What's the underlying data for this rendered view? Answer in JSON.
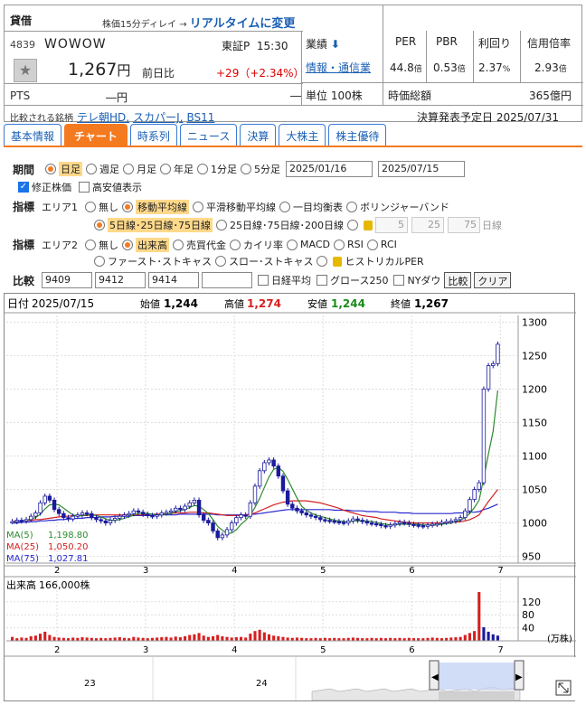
{
  "header": {
    "badge": "貸借",
    "delay_text": "株価15分ディレイ →",
    "realtime_link": "リアルタイムに変更",
    "code": "4839",
    "name": "WOWOW",
    "market": "東証P",
    "time": "15:30",
    "price": "1,267",
    "price_unit": "円",
    "prev_label": "前日比",
    "change": "+29",
    "change_pct": "（+2.34%）",
    "pts_label": "PTS",
    "pts_value": "―円",
    "pts_change": "―",
    "compare_label": "比較される銘柄",
    "compare_links": [
      "テレ朝HD,",
      "スカパーJ,",
      "BS11"
    ],
    "gyoseki_label": "業績",
    "industry": "情報・通信業",
    "lot": "単位 100株",
    "per_label": "PER",
    "per_value": "44.8",
    "per_unit": "倍",
    "pbr_label": "PBR",
    "pbr_value": "0.53",
    "pbr_unit": "倍",
    "yield_label": "利回り",
    "yield_value": "2.37",
    "yield_unit": "%",
    "margin_label": "信用倍率",
    "margin_value": "2.93",
    "margin_unit": "倍",
    "mcap_label": "時価総額",
    "mcap_value": "365億円",
    "earnings_label": "決算発表予定日",
    "earnings_date": "2025/07/31"
  },
  "tabs": [
    "基本情報",
    "チャート",
    "時系列",
    "ニュース",
    "決算",
    "大株主",
    "株主優待"
  ],
  "controls": {
    "period_label": "期間",
    "periods": [
      "日足",
      "週足",
      "月足",
      "年足",
      "1分足",
      "5分足"
    ],
    "date_from": "2025/01/16",
    "date_to": "2025/07/15",
    "adjusted": "修正株価",
    "highlow": "高安値表示",
    "indicator_label": "指標",
    "area1": "エリア1",
    "area1_opts": [
      "無し",
      "移動平均線",
      "平滑移動平均線",
      "一目均衡表",
      "ボリンジャーバンド"
    ],
    "ma_opts": [
      "5日線･25日線･75日線",
      "25日線･75日線･200日線"
    ],
    "custom_ma": [
      "5",
      "25",
      "75"
    ],
    "custom_ma_unit": "日線",
    "area2": "エリア2",
    "area2_opts_a": [
      "無し",
      "出来高",
      "売買代金",
      "カイリ率",
      "MACD",
      "RSI",
      "RCI"
    ],
    "area2_opts_b": [
      "ファースト･ストキャス",
      "スロー･ストキャス",
      "ヒストリカルPER"
    ],
    "compare_label": "比較",
    "compare_codes": [
      "9409",
      "9412",
      "9414",
      ""
    ],
    "compare_indices": [
      "日経平均",
      "グロース250",
      "NYダウ"
    ],
    "compare_btn": "比較",
    "clear_btn": "クリア"
  },
  "chart_info": {
    "date_label": "日付",
    "date": "2025/07/15",
    "open_label": "始値",
    "open": "1,244",
    "high_label": "高値",
    "high": "1,274",
    "low_label": "安値",
    "low": "1,244",
    "close_label": "終値",
    "close": "1,267",
    "ma5": "MA(5)",
    "ma5_val": "1,198.80",
    "ma25": "MA(25)",
    "ma25_val": "1,050.20",
    "ma75": "MA(75)",
    "ma75_val": "1,027.81",
    "volume_label": "出来高",
    "volume_val": "166,000株",
    "volume_unit": "(万株)",
    "nav_labels": [
      "23",
      "24"
    ],
    "colors": {
      "up": "#1a1a9c",
      "down": "#1a1a9c",
      "ma5": "#2e8b2e",
      "ma25": "#d62020",
      "ma75": "#2a2ad0",
      "volume": "#d62020",
      "accent": "#f47a20"
    }
  },
  "chart_data": {
    "type": "candlestick",
    "x_ticks": [
      "2",
      "3",
      "4",
      "5",
      "6",
      "7"
    ],
    "y_ticks": [
      950,
      1000,
      1050,
      1100,
      1150,
      1200,
      1250,
      1300
    ],
    "ylim": [
      940,
      1310
    ],
    "vol_ticks": [
      40,
      80,
      120
    ],
    "vol_ylim": [
      0,
      150
    ],
    "closes": [
      1002,
      1004,
      1003,
      1005,
      1010,
      1015,
      1030,
      1040,
      1034,
      1020,
      1014,
      1008,
      1006,
      1010,
      1012,
      1015,
      1014,
      1008,
      1005,
      1003,
      1000,
      1004,
      1007,
      1010,
      1012,
      1014,
      1018,
      1016,
      1013,
      1011,
      1010,
      1012,
      1015,
      1016,
      1018,
      1022,
      1020,
      1025,
      1030,
      1034,
      1012,
      1004,
      1000,
      988,
      978,
      982,
      990,
      1000,
      1008,
      1012,
      1010,
      1030,
      1055,
      1078,
      1090,
      1094,
      1085,
      1070,
      1048,
      1028,
      1022,
      1018,
      1015,
      1012,
      1010,
      1008,
      1005,
      1004,
      1003,
      1002,
      1001,
      1000,
      1003,
      1006,
      1004,
      1002,
      1000,
      999,
      998,
      996,
      995,
      997,
      999,
      1001,
      1000,
      998,
      997,
      996,
      995,
      997,
      998,
      999,
      1001,
      1002,
      1003,
      1005,
      1008,
      1018,
      1035,
      1050,
      1060,
      1200,
      1235,
      1238,
      1267
    ],
    "ma5": [
      1000,
      1002,
      1003,
      1004,
      1006,
      1008,
      1013,
      1021,
      1027,
      1028,
      1027,
      1022,
      1017,
      1012,
      1010,
      1011,
      1012,
      1012,
      1011,
      1009,
      1006,
      1004,
      1004,
      1005,
      1007,
      1009,
      1012,
      1014,
      1015,
      1014,
      1013,
      1012,
      1012,
      1013,
      1014,
      1017,
      1018,
      1020,
      1023,
      1026,
      1025,
      1020,
      1014,
      1005,
      995,
      989,
      984,
      985,
      990,
      998,
      1004,
      1012,
      1023,
      1037,
      1053,
      1069,
      1080,
      1083,
      1077,
      1065,
      1051,
      1037,
      1025,
      1019,
      1015,
      1012,
      1010,
      1008,
      1006,
      1004,
      1003,
      1002,
      1002,
      1003,
      1003,
      1003,
      1003,
      1002,
      1001,
      999,
      998,
      997,
      997,
      998,
      998,
      998,
      998,
      998,
      997,
      997,
      997,
      997,
      998,
      999,
      1000,
      1002,
      1004,
      1008,
      1014,
      1023,
      1034,
      1067,
      1103,
      1137,
      1198
    ],
    "ma25": [
      1002,
      1003,
      1003,
      1004,
      1004,
      1005,
      1005,
      1006,
      1007,
      1008,
      1009,
      1010,
      1010,
      1011,
      1011,
      1011,
      1011,
      1012,
      1012,
      1012,
      1012,
      1012,
      1012,
      1012,
      1012,
      1012,
      1012,
      1012,
      1012,
      1013,
      1013,
      1013,
      1013,
      1014,
      1014,
      1015,
      1015,
      1015,
      1016,
      1016,
      1016,
      1015,
      1015,
      1014,
      1013,
      1012,
      1011,
      1011,
      1011,
      1011,
      1012,
      1013,
      1015,
      1018,
      1021,
      1024,
      1027,
      1029,
      1031,
      1032,
      1033,
      1033,
      1033,
      1033,
      1032,
      1031,
      1030,
      1028,
      1026,
      1024,
      1022,
      1019,
      1017,
      1015,
      1013,
      1011,
      1010,
      1009,
      1008,
      1006,
      1005,
      1004,
      1003,
      1002,
      1001,
      1001,
      1000,
      1000,
      1000,
      1000,
      1000,
      1000,
      1000,
      1000,
      1001,
      1001,
      1002,
      1003,
      1005,
      1008,
      1012,
      1022,
      1032,
      1041,
      1050
    ],
    "ma75": [
      1000,
      1000,
      1001,
      1001,
      1002,
      1002,
      1003,
      1003,
      1004,
      1004,
      1005,
      1005,
      1006,
      1006,
      1007,
      1007,
      1008,
      1008,
      1008,
      1009,
      1009,
      1009,
      1010,
      1010,
      1010,
      1010,
      1011,
      1011,
      1011,
      1011,
      1011,
      1012,
      1012,
      1012,
      1012,
      1012,
      1013,
      1013,
      1013,
      1013,
      1013,
      1013,
      1013,
      1013,
      1012,
      1012,
      1012,
      1012,
      1012,
      1012,
      1012,
      1013,
      1013,
      1014,
      1015,
      1016,
      1017,
      1018,
      1019,
      1020,
      1020,
      1020,
      1020,
      1020,
      1020,
      1020,
      1020,
      1020,
      1020,
      1019,
      1019,
      1019,
      1019,
      1018,
      1018,
      1018,
      1017,
      1017,
      1017,
      1016,
      1016,
      1016,
      1016,
      1015,
      1015,
      1015,
      1014,
      1014,
      1014,
      1014,
      1014,
      1014,
      1014,
      1014,
      1014,
      1015,
      1015,
      1015,
      1016,
      1016,
      1017,
      1020,
      1022,
      1025,
      1028
    ],
    "volume": [
      12,
      8,
      10,
      9,
      14,
      16,
      22,
      28,
      18,
      12,
      10,
      9,
      8,
      10,
      9,
      11,
      10,
      9,
      8,
      9,
      8,
      9,
      10,
      11,
      9,
      8,
      12,
      10,
      9,
      8,
      9,
      10,
      11,
      12,
      10,
      13,
      11,
      14,
      18,
      20,
      24,
      16,
      12,
      14,
      18,
      14,
      12,
      10,
      11,
      12,
      10,
      22,
      30,
      34,
      26,
      20,
      16,
      14,
      12,
      10,
      9,
      10,
      9,
      8,
      8,
      9,
      8,
      9,
      8,
      9,
      8,
      8,
      9,
      10,
      9,
      8,
      8,
      9,
      8,
      9,
      8,
      9,
      8,
      9,
      8,
      9,
      8,
      8,
      8,
      9,
      10,
      9,
      8,
      9,
      10,
      11,
      12,
      18,
      24,
      30,
      166,
      42,
      28,
      20,
      16
    ]
  }
}
